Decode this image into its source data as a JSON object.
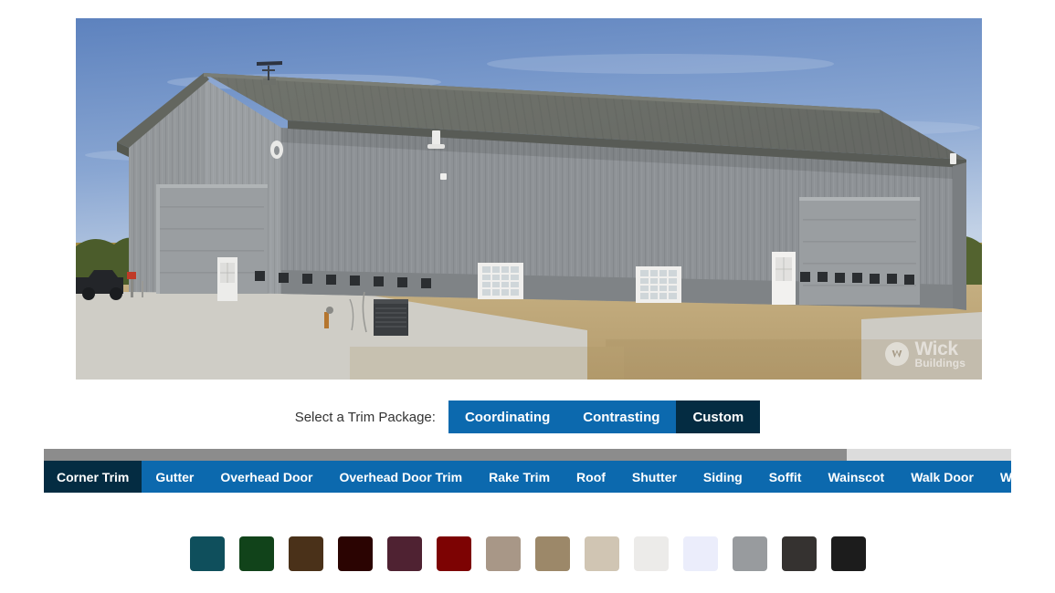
{
  "preview": {
    "alt_description": "Gray steel pole barn building with gabled roof, two overhead doors, walk door, windows and cornfield background",
    "watermark": {
      "brand_line1": "Wick",
      "brand_line2": "Buildings",
      "icon": "wick-logo-icon"
    },
    "colors": {
      "sky_top": "#5f84bf",
      "sky_bottom": "#b9cbe4",
      "wall": "#8e9296",
      "wall_shadow": "#7c8085",
      "roof": "#6c6f6c",
      "roof_shadow": "#5e6160",
      "gable_wall": "#999da0",
      "corn": "#b99b45",
      "gravel": "#bda778",
      "concrete": "#cfcdc6"
    }
  },
  "trim_package": {
    "label": "Select a Trim Package:",
    "options": [
      {
        "label": "Coordinating",
        "active": false
      },
      {
        "label": "Contrasting",
        "active": false
      },
      {
        "label": "Custom",
        "active": true
      }
    ],
    "active_color": "#042C42",
    "inactive_color": "#0C69AE"
  },
  "tabs": {
    "scroll_thumb_percent": 83,
    "items": [
      {
        "label": "Corner Trim",
        "active": true
      },
      {
        "label": "Gutter",
        "active": false
      },
      {
        "label": "Overhead Door",
        "active": false
      },
      {
        "label": "Overhead Door Trim",
        "active": false
      },
      {
        "label": "Rake Trim",
        "active": false
      },
      {
        "label": "Roof",
        "active": false
      },
      {
        "label": "Shutter",
        "active": false
      },
      {
        "label": "Siding",
        "active": false
      },
      {
        "label": "Soffit",
        "active": false
      },
      {
        "label": "Wainscot",
        "active": false
      },
      {
        "label": "Walk Door",
        "active": false
      },
      {
        "label": "Window",
        "active": false
      }
    ]
  },
  "swatches": {
    "items": [
      {
        "name": "teal",
        "hex": "#0F4F5C"
      },
      {
        "name": "forest-green",
        "hex": "#11431A"
      },
      {
        "name": "brown",
        "hex": "#4A3119"
      },
      {
        "name": "dark-maroon",
        "hex": "#2B0402"
      },
      {
        "name": "plum",
        "hex": "#4F2232"
      },
      {
        "name": "red",
        "hex": "#7D0303"
      },
      {
        "name": "taupe",
        "hex": "#A89787"
      },
      {
        "name": "khaki",
        "hex": "#9C8869"
      },
      {
        "name": "beige",
        "hex": "#D0C5B3"
      },
      {
        "name": "off-white",
        "hex": "#ECEBE9"
      },
      {
        "name": "pale-blue-white",
        "hex": "#EBEDFB"
      },
      {
        "name": "gray",
        "hex": "#989B9E"
      },
      {
        "name": "charcoal",
        "hex": "#353230"
      },
      {
        "name": "black",
        "hex": "#1C1C1C"
      }
    ]
  }
}
